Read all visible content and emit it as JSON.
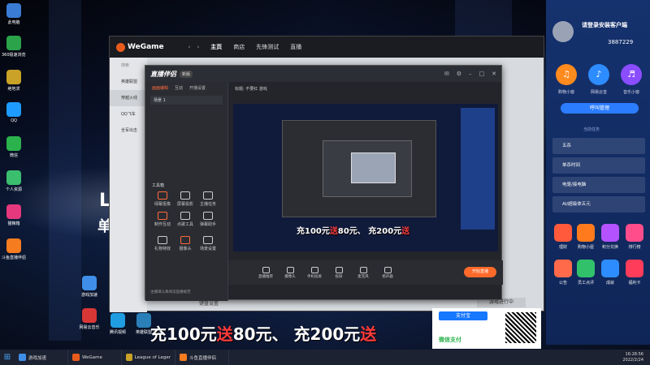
{
  "desktop": {
    "icons": [
      {
        "label": "此电脑",
        "icon": "computer-icon",
        "color": "#3a7bd5"
      },
      {
        "label": "360极速浏览器",
        "icon": "browser-icon",
        "color": "#2aa34a"
      },
      {
        "label": "绝地求",
        "icon": "game-icon",
        "color": "#c9a227"
      },
      {
        "label": "QQ",
        "icon": "qq-icon",
        "color": "#1e9bff"
      },
      {
        "label": "微信",
        "icon": "wechat-icon",
        "color": "#2bb24c"
      },
      {
        "label": "个人资源",
        "icon": "resource-icon",
        "color": "#3bbf6e"
      },
      {
        "label": "猫粮箱",
        "icon": "shop-icon",
        "color": "#e5387d"
      },
      {
        "label": "斗鱼直播伴侣",
        "icon": "douyu-icon",
        "color": "#f57c1f"
      },
      {
        "label": "游戏加速",
        "icon": "cloud-icon",
        "color": "#3f8fe8"
      },
      {
        "label": "网易云音乐",
        "icon": "music-icon",
        "color": "#d93636"
      },
      {
        "label": "腾讯视频",
        "icon": "video-icon",
        "color": "#1f9de0"
      },
      {
        "label": "英雄联盟",
        "icon": "lol-icon",
        "color": "#2a7fb8"
      }
    ]
  },
  "wegame": {
    "logo": "WeGame",
    "nav": [
      "主页",
      "商店",
      "先锋测试",
      "直播"
    ],
    "sidebar": [
      "英雄联盟",
      "穿越火线",
      "QQ飞车",
      "全军出击"
    ],
    "search_placeholder": "搜索",
    "settings_label": "键盘设置",
    "game_label": "游戏进行中"
  },
  "stream": {
    "logo": "直播伴侣",
    "version": "新版",
    "tabs": [
      "画面编辑",
      "互动",
      "开播设置"
    ],
    "scene_label": "场景 1",
    "title_prefix": "标题:",
    "title_value": "不要红 游戏",
    "tools_header": "工具箱",
    "tools": [
      "绿幕抠像",
      "屏幕投影",
      "主播任务",
      "制作互动",
      "点歌工具",
      "弹幕助手",
      "礼物特效",
      "摄像头",
      "场景设置"
    ],
    "bottom_items": [
      "直播推荐",
      "摄像头",
      "手机投屏",
      "投屏",
      "麦克风",
      "扬声器"
    ],
    "live_button": "开始直播",
    "notice": "主播请认真阅读直播规范"
  },
  "promo": {
    "prefix1": "充100元",
    "red1": "送",
    "mid": "80元、 充200元",
    "red2": "送"
  },
  "right_panel": {
    "login_text": "请登录安装客户端",
    "id_number": "3887229",
    "circles": [
      {
        "label": "购物小窗",
        "color": "#ff8a1e"
      },
      {
        "label": "网易云音",
        "color": "#2d8cff"
      },
      {
        "label": "音乐小窗",
        "color": "#8a4dff"
      }
    ],
    "main_button": "呼叫管理",
    "section_label": "当前任务",
    "rows": [
      "五杀",
      "单杀时间",
      "电驱/接电脑",
      "AI/超级体五元"
    ],
    "tiles": [
      {
        "label": "理财",
        "color": "#ff5a3c"
      },
      {
        "label": "购物小屋",
        "color": "#ff7a1c"
      },
      {
        "label": "积分兑换",
        "color": "#b452ff"
      },
      {
        "label": "排行榜",
        "color": "#ff4c8b"
      },
      {
        "label": "公告",
        "color": "#ff6a4a"
      },
      {
        "label": "员工点评",
        "color": "#31c16b"
      },
      {
        "label": "成就",
        "color": "#2d8cff"
      },
      {
        "label": "福利卡",
        "color": "#ff3c5a"
      }
    ]
  },
  "payment": {
    "alipay": "支付宝",
    "wechat": "微信支付"
  },
  "taskbar": {
    "apps": [
      {
        "label": "游戏加速",
        "color": "#3f8fe8"
      },
      {
        "label": "WeGame",
        "color": "#e95b1d"
      },
      {
        "label": "League of Legends",
        "color": "#c9a227"
      },
      {
        "label": "斗鱼直播伴侣",
        "color": "#f57c1f"
      }
    ],
    "time": "16:28:56",
    "date": "2022/2/24"
  }
}
